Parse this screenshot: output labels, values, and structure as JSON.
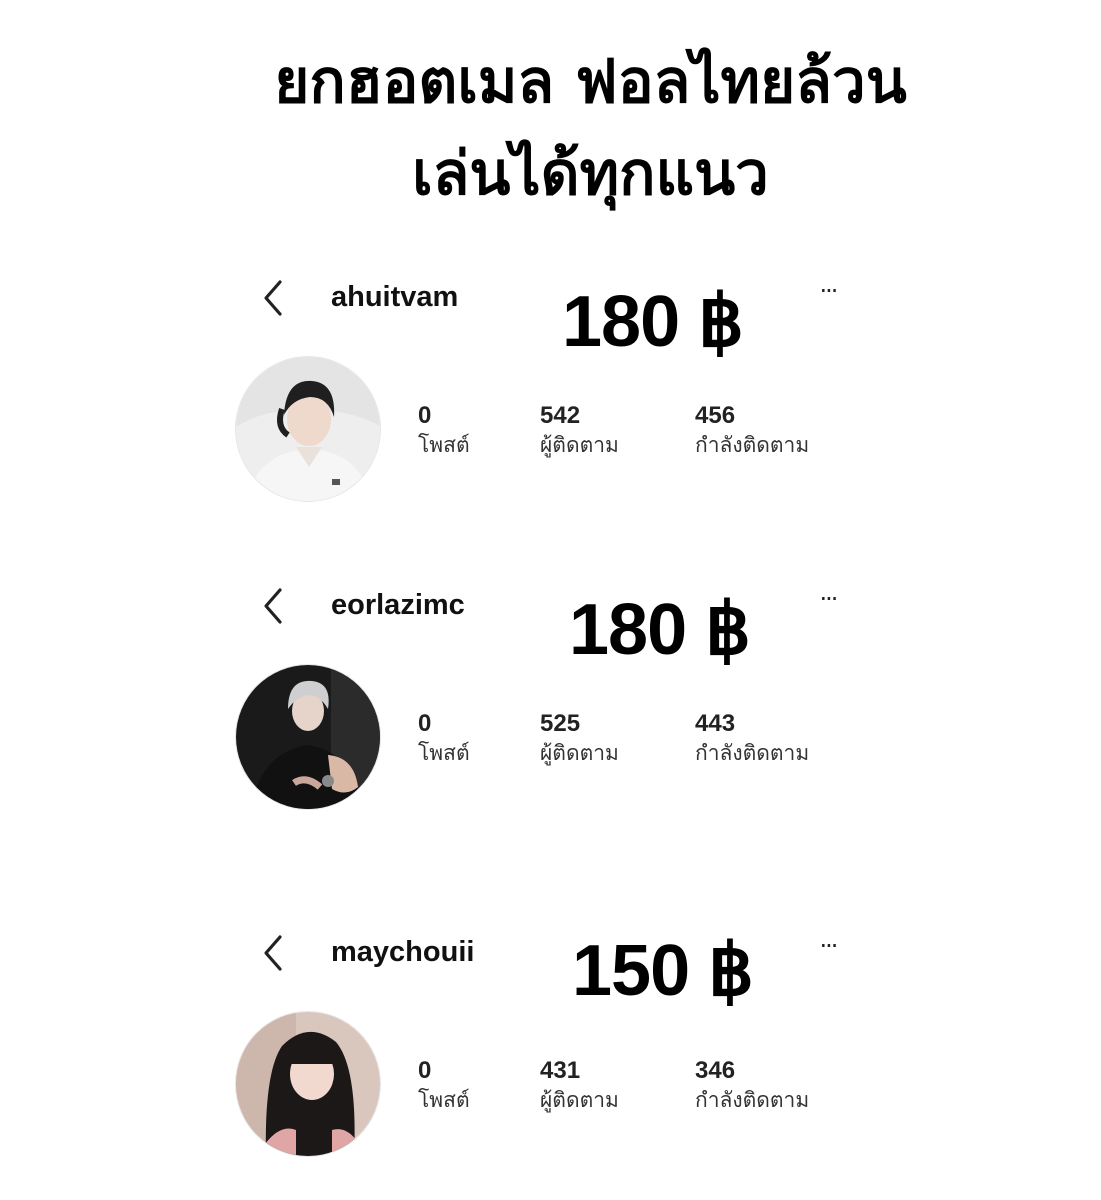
{
  "headline": {
    "line1": "ยกฮอตเมล ฟอลไทยล้วน",
    "line2": "เล่นได้ทุกแนว"
  },
  "accounts": [
    {
      "username": "ahuitvam",
      "price": "180 ฿",
      "stats": {
        "posts": "0",
        "followers": "542",
        "following": "456"
      }
    },
    {
      "username": "eorlazimc",
      "price": "180 ฿",
      "stats": {
        "posts": "0",
        "followers": "525",
        "following": "443"
      }
    },
    {
      "username": "maychouii",
      "price": "150 ฿",
      "stats": {
        "posts": "0",
        "followers": "431",
        "following": "346"
      }
    }
  ],
  "labels": {
    "posts": "โพสต์",
    "followers": "ผู้ติดตาม",
    "following": "กำลังติดตาม",
    "more": "···"
  },
  "icons": {
    "back": "chevron-left-icon",
    "more": "more-horizontal-icon"
  },
  "colors": {
    "background": "#ffffff",
    "text": "#111111"
  }
}
